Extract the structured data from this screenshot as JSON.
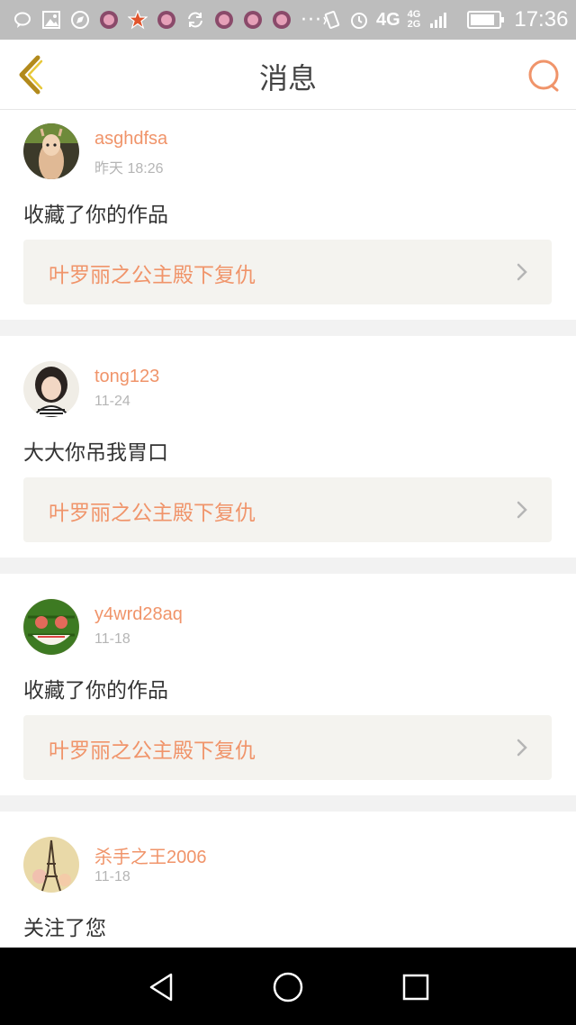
{
  "status_bar": {
    "network": "4G",
    "network_secondary_top": "4G",
    "network_secondary_bottom": "2G",
    "time": "17:36",
    "battery_level": 0.75,
    "overflow": "···",
    "icons": [
      "chat-bubble-icon",
      "image-icon",
      "compass-icon",
      "app-icon",
      "star-icon",
      "app-icon",
      "sync-icon",
      "app-icon",
      "app-icon",
      "app-icon",
      "vibrate-icon",
      "alarm-icon"
    ]
  },
  "header": {
    "title": "消息",
    "back_icon": "chevron-left-icon",
    "search_icon": "search-icon",
    "accent_color": "#f0946a"
  },
  "messages": [
    {
      "username": "asghdfsa",
      "time": "昨天 18:26",
      "action": "收藏了你的作品",
      "work_title": "叶罗丽之公主殿下复仇",
      "avatar": "alpaca-avatar"
    },
    {
      "username": "tong123",
      "time": "11-24",
      "action": "大大你吊我胃口",
      "work_title": "叶罗丽之公主殿下复仇",
      "avatar": "girl-avatar"
    },
    {
      "username": "y4wrd28aq",
      "time": "11-18",
      "action": "收藏了你的作品",
      "work_title": "叶罗丽之公主殿下复仇",
      "avatar": "watermelon-avatar"
    },
    {
      "username": "杀手之王2006",
      "time": "11-18",
      "action": "关注了您",
      "avatar": "eiffel-tower-avatar"
    }
  ],
  "nav": {
    "back": "triangle-back-icon",
    "home": "circle-home-icon",
    "recents": "square-recents-icon"
  }
}
